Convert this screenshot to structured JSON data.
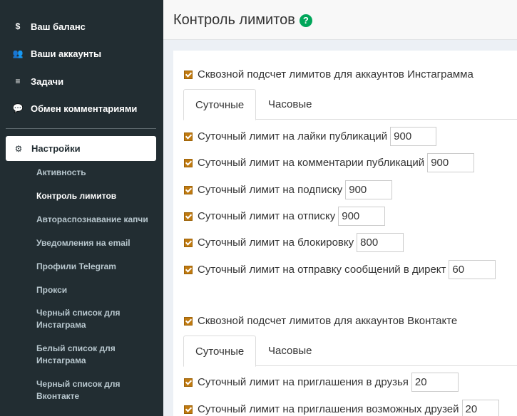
{
  "sidebar": {
    "items": [
      {
        "icon": "dollar-icon",
        "glyph": "$",
        "label": "Ваш баланс"
      },
      {
        "icon": "users-icon",
        "glyph": "👥",
        "label": "Ваши аккаунты"
      },
      {
        "icon": "tasks-icon",
        "glyph": "≡",
        "label": "Задачи"
      },
      {
        "icon": "comments-icon",
        "glyph": "💬",
        "label": "Обмен комментариями"
      }
    ],
    "settings": {
      "icon": "gear-icon",
      "glyph": "⚙",
      "label": "Настройки"
    },
    "sub_items": [
      {
        "label": "Активность"
      },
      {
        "label": "Контроль лимитов"
      },
      {
        "label": "Автораспознавание капчи"
      },
      {
        "label": "Уведомления на email"
      },
      {
        "label": "Профили Telegram"
      },
      {
        "label": "Прокси"
      },
      {
        "label": "Черный список для Инстаграма"
      },
      {
        "label": "Белый список для Инстаграма"
      },
      {
        "label": "Черный список для Вконтакте"
      }
    ]
  },
  "header": {
    "title": "Контроль лимитов",
    "help_glyph": "?"
  },
  "instagram": {
    "master_label": "Сквозной подсчет лимитов для аккаунтов Инстаграмма",
    "tabs": [
      "Суточные",
      "Часовые"
    ],
    "limits": [
      {
        "label": "Суточный лимит на лайки публикаций",
        "value": "900"
      },
      {
        "label": "Суточный лимит на комментарии публикаций",
        "value": "900"
      },
      {
        "label": "Суточный лимит на подписку",
        "value": "900"
      },
      {
        "label": "Суточный лимит на отписку",
        "value": "900"
      },
      {
        "label": "Суточный лимит на блокировку",
        "value": "800"
      },
      {
        "label": "Суточный лимит на отправку сообщений в директ",
        "value": "60"
      }
    ]
  },
  "vkontakte": {
    "master_label": "Сквозной подсчет лимитов для аккаунтов Вконтакте",
    "tabs": [
      "Суточные",
      "Часовые"
    ],
    "limits": [
      {
        "label": "Суточный лимит на приглашения в друзья",
        "value": "20"
      },
      {
        "label": "Суточный лимит на приглашения возможных друзей",
        "value": "20"
      }
    ]
  }
}
